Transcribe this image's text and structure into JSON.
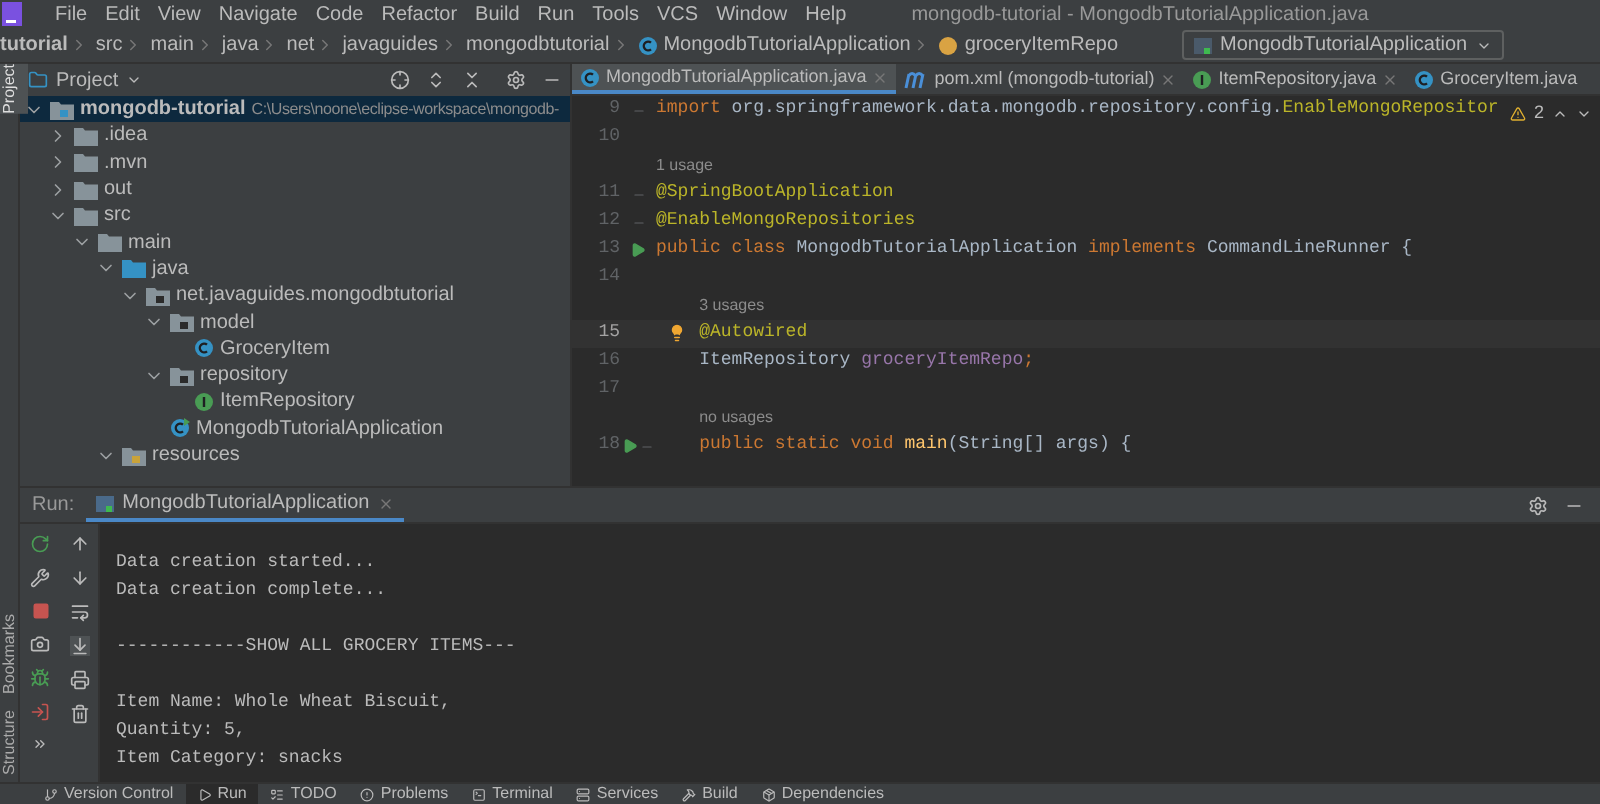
{
  "menu": [
    "File",
    "Edit",
    "View",
    "Navigate",
    "Code",
    "Refactor",
    "Build",
    "Run",
    "Tools",
    "VCS",
    "Window",
    "Help"
  ],
  "window": {
    "title": "mongodb-tutorial - MongodbTutorialApplication.java"
  },
  "breadcrumbs": [
    {
      "label": "tutorial",
      "kind": "project"
    },
    {
      "label": "src",
      "kind": "folder"
    },
    {
      "label": "main",
      "kind": "folder"
    },
    {
      "label": "java",
      "kind": "folder"
    },
    {
      "label": "net",
      "kind": "folder"
    },
    {
      "label": "javaguides",
      "kind": "folder"
    },
    {
      "label": "mongodbtutorial",
      "kind": "folder"
    },
    {
      "label": "MongodbTutorialApplication",
      "kind": "class"
    },
    {
      "label": "groceryItemRepo",
      "kind": "field"
    }
  ],
  "run_config": {
    "label": "MongodbTutorialApplication"
  },
  "side_strip": [
    {
      "label": "Project",
      "selected": true
    },
    {
      "label": "Bookmarks",
      "selected": false
    },
    {
      "label": "Structure",
      "selected": false
    }
  ],
  "project": {
    "title": "Project",
    "tree": [
      {
        "name": "mongodb-tutorial",
        "path": "C:\\Users\\noone\\eclipse-workspace\\mongodb-",
        "kind": "module",
        "expanded": true,
        "selected": true,
        "children": [
          {
            "name": ".idea",
            "kind": "folder",
            "expanded": false,
            "selected": false
          },
          {
            "name": ".mvn",
            "kind": "folder",
            "expanded": false,
            "selected": false
          },
          {
            "name": "out",
            "kind": "folder",
            "expanded": false,
            "selected": false
          },
          {
            "name": "src",
            "kind": "folder",
            "expanded": true,
            "selected": false,
            "children": [
              {
                "name": "main",
                "kind": "folder",
                "expanded": true,
                "selected": false,
                "children": [
                  {
                    "name": "java",
                    "kind": "source_folder",
                    "expanded": true,
                    "selected": false,
                    "children": [
                      {
                        "name": "net.javaguides.mongodbtutorial",
                        "kind": "package",
                        "expanded": true,
                        "selected": false,
                        "children": [
                          {
                            "name": "model",
                            "kind": "package",
                            "expanded": true,
                            "selected": false,
                            "children": [
                              {
                                "name": "GroceryItem",
                                "kind": "class",
                                "selected": false
                              }
                            ]
                          },
                          {
                            "name": "repository",
                            "kind": "package",
                            "expanded": true,
                            "selected": false,
                            "children": [
                              {
                                "name": "ItemRepository",
                                "kind": "interface",
                                "selected": false
                              }
                            ]
                          },
                          {
                            "name": "MongodbTutorialApplication",
                            "kind": "main_class",
                            "selected": false
                          }
                        ]
                      }
                    ]
                  },
                  {
                    "name": "resources",
                    "kind": "resources",
                    "expanded": true,
                    "selected": false
                  }
                ]
              }
            ]
          }
        ]
      }
    ]
  },
  "editor": {
    "tabs": [
      {
        "label": "MongodbTutorialApplication.java",
        "kind": "class",
        "selected": true,
        "closable": true
      },
      {
        "label": "pom.xml (mongodb-tutorial)",
        "kind": "maven",
        "selected": false,
        "closable": true
      },
      {
        "label": "ItemRepository.java",
        "kind": "interface",
        "selected": false,
        "closable": true
      },
      {
        "label": "GroceryItem.java",
        "kind": "class",
        "selected": false,
        "closable": false
      }
    ],
    "warnings": "2",
    "lines": [
      {
        "number": "9",
        "fold": true,
        "run": false,
        "current": false,
        "tokens": [
          {
            "text": "import",
            "kind": "keyword"
          },
          {
            "text": " org.springframework.data.mongodb.repository.config.",
            "kind": "plain"
          },
          {
            "text": "EnableMongoRepositor",
            "kind": "annotation"
          }
        ]
      },
      {
        "number": "10",
        "fold": false,
        "run": false,
        "current": false
      },
      {
        "number": "11",
        "hint": "1 usage",
        "fold": true,
        "run": false,
        "current": false,
        "tokens": [
          {
            "text": "@SpringBootApplication",
            "kind": "annotation"
          }
        ]
      },
      {
        "number": "12",
        "fold": true,
        "run": false,
        "current": false,
        "tokens": [
          {
            "text": "@EnableMongoRepositories",
            "kind": "annotation"
          }
        ]
      },
      {
        "number": "13",
        "fold": false,
        "run": true,
        "current": false,
        "tokens": [
          {
            "text": "public class ",
            "kind": "keyword"
          },
          {
            "text": "MongodbTutorialApplication ",
            "kind": "plain"
          },
          {
            "text": "implements ",
            "kind": "keyword"
          },
          {
            "text": "CommandLineRunner {",
            "kind": "plain"
          }
        ]
      },
      {
        "number": "14",
        "fold": false,
        "run": false,
        "current": false
      },
      {
        "number": "15",
        "hint": "3 usages",
        "fold": false,
        "run": false,
        "current": true,
        "bulb": true,
        "tokens": [
          {
            "text": "    @Autowired",
            "kind": "annotation"
          }
        ]
      },
      {
        "number": "16",
        "fold": false,
        "run": false,
        "current": false,
        "tokens": [
          {
            "text": "    ItemRepository ",
            "kind": "plain"
          },
          {
            "text": "groceryItemRepo",
            "kind": "field"
          },
          {
            "text": ";",
            "kind": "keyword"
          }
        ]
      },
      {
        "number": "17",
        "fold": false,
        "run": false,
        "current": false
      },
      {
        "number": "18",
        "hint": "no usages",
        "fold": true,
        "run": true,
        "current": false,
        "tokens": [
          {
            "text": "    public static void ",
            "kind": "keyword"
          },
          {
            "text": "main",
            "kind": "method"
          },
          {
            "text": "(String[] args) {",
            "kind": "plain"
          }
        ]
      }
    ]
  },
  "run": {
    "label": "Run:",
    "tabs": [
      {
        "label": "MongodbTutorialApplication",
        "selected": true
      }
    ],
    "console": [
      {
        "kind": "text",
        "text": "Data creation started..."
      },
      {
        "kind": "text",
        "text": "Data creation complete..."
      },
      {
        "kind": "blank"
      },
      {
        "kind": "text",
        "text": "------------SHOW ALL GROCERY ITEMS---"
      },
      {
        "kind": "blank"
      },
      {
        "kind": "text",
        "text": "Item Name: Whole Wheat Biscuit,"
      },
      {
        "kind": "text",
        "text": "Quantity: 5,"
      },
      {
        "kind": "text",
        "text": "Item Category: snacks"
      }
    ]
  },
  "bottom_tabs": [
    {
      "label": "Version Control",
      "kind": "vcs",
      "selected": false
    },
    {
      "label": "Run",
      "kind": "run",
      "selected": true
    },
    {
      "label": "TODO",
      "kind": "todo",
      "selected": false
    },
    {
      "label": "Problems",
      "kind": "problems",
      "selected": false
    },
    {
      "label": "Terminal",
      "kind": "terminal",
      "selected": false
    },
    {
      "label": "Services",
      "kind": "services",
      "selected": false
    },
    {
      "label": "Build",
      "kind": "build",
      "selected": false
    },
    {
      "label": "Dependencies",
      "kind": "dependencies",
      "selected": false
    }
  ]
}
